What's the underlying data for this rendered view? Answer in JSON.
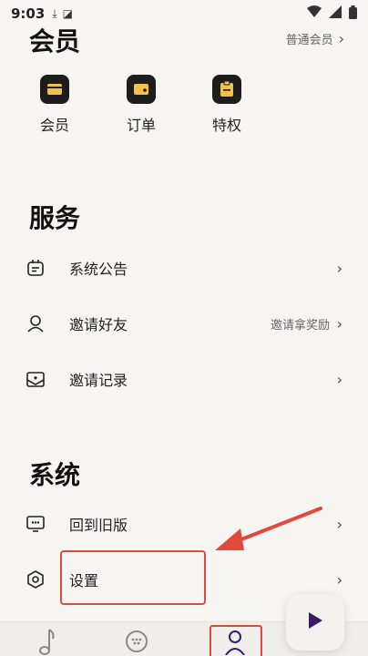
{
  "status_bar": {
    "time": "9:03",
    "icons": [
      "download-icon",
      "app-icon"
    ],
    "right_icons": [
      "wifi-icon",
      "signal-icon",
      "battery-icon"
    ]
  },
  "member": {
    "title": "会员",
    "level": "普通会员",
    "items": [
      {
        "label": "会员",
        "icon": "wallet-icon"
      },
      {
        "label": "订单",
        "icon": "order-wallet-icon"
      },
      {
        "label": "特权",
        "icon": "privilege-clipboard-icon"
      }
    ]
  },
  "services": {
    "title": "服务",
    "rows": [
      {
        "label": "系统公告",
        "icon": "announcement-icon",
        "extra": ""
      },
      {
        "label": "邀请好友",
        "icon": "invite-friend-icon",
        "extra": "邀请拿奖励"
      },
      {
        "label": "邀请记录",
        "icon": "invite-record-icon",
        "extra": ""
      }
    ]
  },
  "system": {
    "title": "系统",
    "rows": [
      {
        "label": "回到旧版",
        "icon": "monitor-icon",
        "extra": ""
      },
      {
        "label": "设置",
        "icon": "settings-icon",
        "extra": ""
      }
    ]
  },
  "tabbar": {
    "tabs": [
      {
        "name": "music",
        "icon": "music-note-icon"
      },
      {
        "name": "discover",
        "icon": "discover-icon"
      },
      {
        "name": "profile",
        "icon": "profile-icon",
        "active": true
      }
    ]
  },
  "annotation_color": "#e14a3a",
  "play_color": "#3a1a6b"
}
